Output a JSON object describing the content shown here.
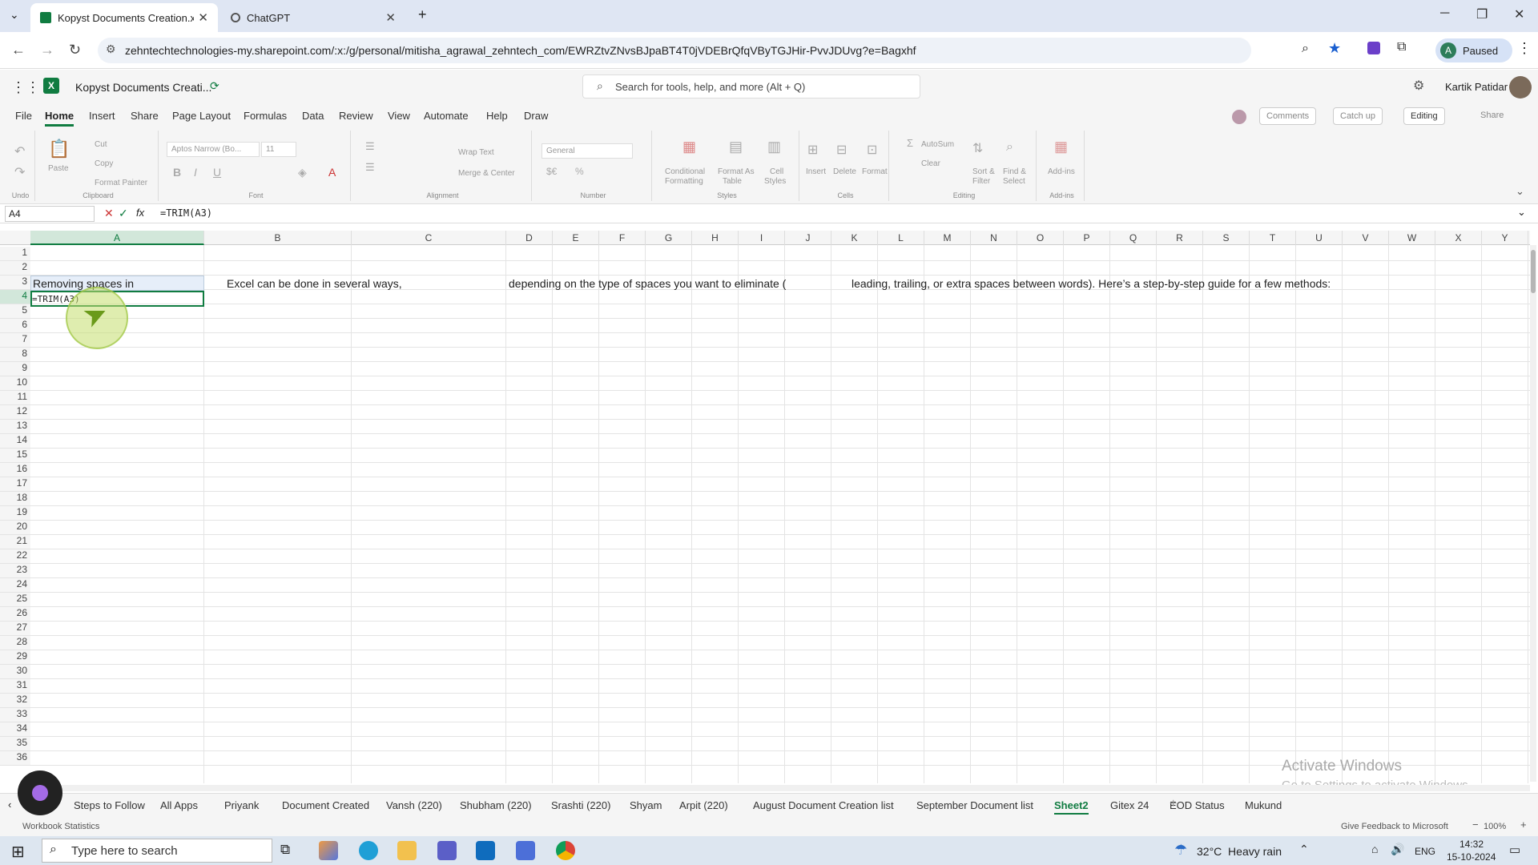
{
  "browser": {
    "tabs": [
      {
        "label": "Kopyst Documents Creation.xls",
        "active": true
      },
      {
        "label": "ChatGPT",
        "active": false
      }
    ],
    "url": "zehntechtechnologies-my.sharepoint.com/:x:/g/personal/mitisha_agrawal_zehntech_com/EWRZtvZNvsBJpaBT4T0jVDEBrQfqVByTGJHir-PvvJDUvg?e=Bagxhf",
    "profile_initial": "A",
    "profile_status": "Paused"
  },
  "excel": {
    "doc_title": "Kopyst Documents Creati...",
    "search_placeholder": "Search for tools, help, and more (Alt + Q)",
    "user_name": "Kartik Patidar",
    "menus": [
      "File",
      "Home",
      "Insert",
      "Share",
      "Page Layout",
      "Formulas",
      "Data",
      "Review",
      "View",
      "Automate",
      "Help",
      "Draw"
    ],
    "menu_buttons": {
      "comments": "Comments",
      "catchup": "Catch up",
      "editing": "Editing",
      "share": "Share"
    },
    "ribbon": {
      "undo": "Undo",
      "paste": "Paste",
      "cut": "Cut",
      "copy": "Copy",
      "format_painter": "Format Painter",
      "clipboard": "Clipboard",
      "font_name": "Aptos Narrow (Bo...",
      "font_size": "11",
      "font": "Font",
      "wrap_text": "Wrap Text",
      "merge_center": "Merge & Center",
      "alignment": "Alignment",
      "number_format": "General",
      "number": "Number",
      "cond_fmt_1": "Conditional",
      "cond_fmt_2": "Formatting",
      "fmt_table_1": "Format As",
      "fmt_table_2": "Table",
      "cell_styles_1": "Cell",
      "cell_styles_2": "Styles",
      "styles": "Styles",
      "insert": "Insert",
      "delete": "Delete",
      "format": "Format",
      "cells": "Cells",
      "autosum": "AutoSum",
      "clear": "Clear",
      "sort_1": "Sort &",
      "sort_2": "Filter",
      "find_1": "Find &",
      "find_2": "Select",
      "editing": "Editing",
      "addins": "Add-ins",
      "addins_grp": "Add-ins"
    },
    "name_box": "A4",
    "formula": "=TRIM(A3)",
    "columns": [
      "A",
      "B",
      "C",
      "D",
      "E",
      "F",
      "G",
      "H",
      "I",
      "J",
      "K",
      "L",
      "M",
      "N",
      "O",
      "P",
      "Q",
      "R",
      "S",
      "T",
      "U",
      "V",
      "W",
      "X",
      "Y"
    ],
    "rows": [
      "1",
      "2",
      "3",
      "4",
      "5",
      "6",
      "7",
      "8",
      "9",
      "10",
      "11",
      "12",
      "13",
      "14",
      "15",
      "16",
      "17",
      "18",
      "19",
      "20",
      "21",
      "22",
      "23",
      "24",
      "25",
      "26",
      "27",
      "28",
      "29",
      "30",
      "31",
      "32",
      "33",
      "34",
      "35",
      "36"
    ],
    "cells": {
      "A3": "Removing spaces in",
      "B3": "Excel can be done in several ways,",
      "D3": "depending on the type of spaces you want to eliminate (",
      "K3": "leading, trailing, or extra spaces between words). Here’s a step-by-step guide for a few methods:",
      "A4": "=TRIM(A3)"
    },
    "watermark": {
      "line1": "Activate Windows",
      "line2": "Go to Settings to activate Windows."
    },
    "sheets": [
      "Steps to Follow",
      "All Apps",
      "Priyank",
      "Document Created",
      "Vansh (220)",
      "Shubham (220)",
      "Srashti (220)",
      "Shyam",
      "Arpit (220)",
      "August Document Creation list",
      "September Document list",
      "Sheet2",
      "Gitex 24",
      "EOD Status",
      "Mukund"
    ],
    "active_sheet": "Sheet2",
    "status_left": "Workbook Statistics",
    "status_feedback": "Give Feedback to Microsoft",
    "zoom": "100%"
  },
  "taskbar": {
    "search_placeholder": "Type here to search",
    "weather": "32°C  Heavy rain",
    "lang": "ENG",
    "time": "14:32",
    "date": "15-10-2024"
  },
  "colors": {
    "excel_green": "#107c41",
    "selection_fill": "#d2e7da"
  }
}
